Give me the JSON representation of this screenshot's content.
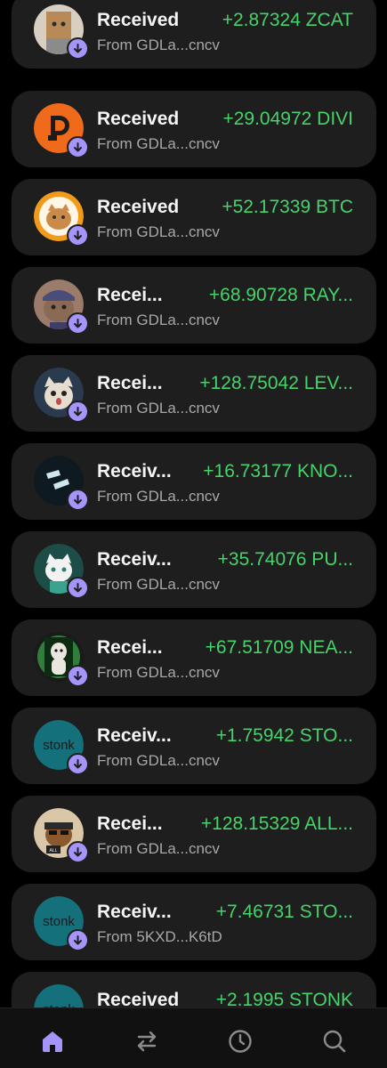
{
  "transactions": [
    {
      "title": "Received",
      "amount": "+2.87324 ZCAT",
      "from": "From GDLa...cncv",
      "icon": "zcat-token-icon"
    },
    {
      "title": "Received",
      "amount": "+29.04972 DIVI",
      "from": "From GDLa...cncv",
      "icon": "divi-token-icon"
    },
    {
      "title": "Received",
      "amount": "+52.17339 BTC",
      "from": "From GDLa...cncv",
      "icon": "btc-cat-token-icon"
    },
    {
      "title": "Recei...",
      "amount": "+68.90728 RAY...",
      "from": "From GDLa...cncv",
      "icon": "ray-cat-token-icon"
    },
    {
      "title": "Recei...",
      "amount": "+128.75042 LEV...",
      "from": "From GDLa...cncv",
      "icon": "lev-cat-token-icon"
    },
    {
      "title": "Receiv...",
      "amount": "+16.73177 KNO...",
      "from": "From GDLa...cncv",
      "icon": "kno-token-icon"
    },
    {
      "title": "Receiv...",
      "amount": "+35.74076 PU...",
      "from": "From GDLa...cncv",
      "icon": "pu-cat-token-icon"
    },
    {
      "title": "Recei...",
      "amount": "+67.51709 NEA...",
      "from": "From GDLa...cncv",
      "icon": "nea-token-icon"
    },
    {
      "title": "Receiv...",
      "amount": "+1.75942 STO...",
      "from": "From GDLa...cncv",
      "icon": "stonk-token-icon",
      "logo_text": "stonk"
    },
    {
      "title": "Recei...",
      "amount": "+128.15329 ALL...",
      "from": "From GDLa...cncv",
      "icon": "all-dog-token-icon"
    },
    {
      "title": "Receiv...",
      "amount": "+7.46731 STO...",
      "from": "From 5KXD...K6tD",
      "icon": "stonk-token-icon",
      "logo_text": "stonk"
    },
    {
      "title": "Received",
      "amount": "+2.1995 STONK",
      "from": "",
      "icon": "stonk-token-icon",
      "logo_text": "stonk"
    }
  ],
  "nav": [
    {
      "name": "home",
      "icon": "home-icon",
      "active": true
    },
    {
      "name": "swap",
      "icon": "swap-icon",
      "active": false
    },
    {
      "name": "activity",
      "icon": "clock-icon",
      "active": false
    },
    {
      "name": "search",
      "icon": "search-icon",
      "active": false
    }
  ],
  "colors": {
    "background": "#000000",
    "card": "#1e1e1f",
    "amount_green": "#46d36a",
    "accent_purple": "#a594f9",
    "muted_text": "#a8a8aa"
  }
}
